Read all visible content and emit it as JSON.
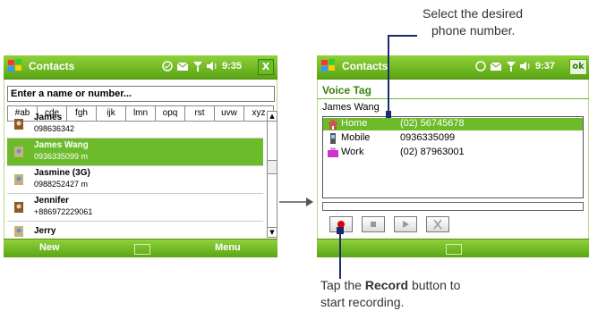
{
  "left": {
    "title": "Contacts",
    "time": "9:35",
    "close": "X",
    "search_placeholder": "Enter a name or number...",
    "tabs": [
      "#ab",
      "cde",
      "fgh",
      "ijk",
      "lmn",
      "opq",
      "rst",
      "uvw",
      "xyz"
    ],
    "contacts": [
      {
        "name": "James",
        "number": "098636342"
      },
      {
        "name": "James Wang",
        "number": "0936335099  m"
      },
      {
        "name": "Jasmine (3G)",
        "number": "0988252427  m"
      },
      {
        "name": "Jennifer",
        "number": "+886972229061"
      },
      {
        "name": "Jerry",
        "number": ""
      }
    ],
    "menu_new": "New",
    "menu_menu": "Menu"
  },
  "right": {
    "title": "Contacts",
    "time": "9:37",
    "ok": "ok",
    "voice_tag": "Voice Tag",
    "contact_name": "James Wang",
    "phones": [
      {
        "label": "Home",
        "number": "(02) 56745678"
      },
      {
        "label": "Mobile",
        "number": "0936335099"
      },
      {
        "label": "Work",
        "number": "(02) 87963001"
      }
    ]
  },
  "callouts": {
    "top_line1": "Select the desired",
    "top_line2": "phone number.",
    "bottom_pre": "Tap the ",
    "bottom_bold": "Record",
    "bottom_post": " button to",
    "bottom_line2": "start recording."
  },
  "colors": {
    "accent": "#6cbb2a",
    "title_green": "#5aa514",
    "callout_line": "#1f2a6b"
  }
}
